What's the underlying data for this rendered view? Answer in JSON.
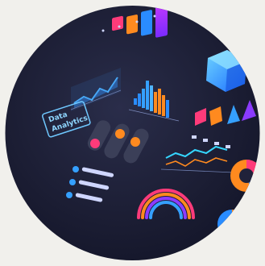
{
  "image": {
    "description_free": true
  },
  "sign": {
    "line1": "Data",
    "line2": "Analytics"
  },
  "colors": {
    "background": "#f1f0ec",
    "disc": "#20223a",
    "pink": "#ff3b7a",
    "orange": "#ff8a1f",
    "blue": "#2a8cff",
    "cyan": "#35d6ff",
    "purple": "#8b3bff",
    "magenta": "#d13cff"
  }
}
